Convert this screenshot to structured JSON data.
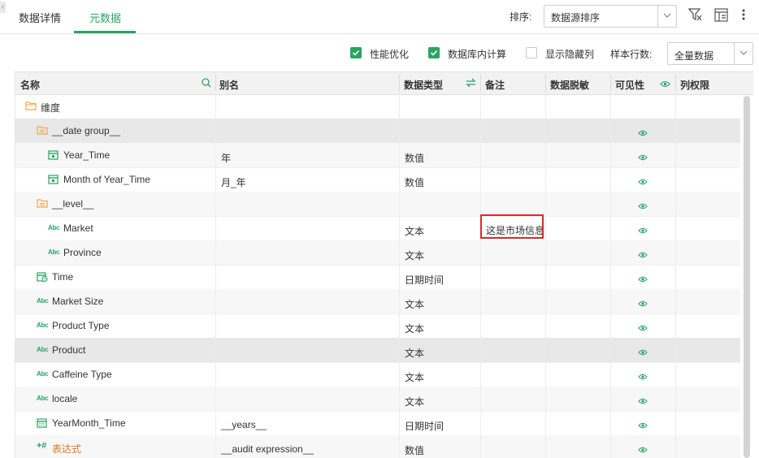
{
  "tabs": [
    {
      "label": "数据详情",
      "active": false
    },
    {
      "label": "元数据",
      "active": true
    }
  ],
  "toolbar": {
    "sort_label": "排序:",
    "sort_value": "数据源排序"
  },
  "options": {
    "perf_opt": {
      "label": "性能优化",
      "checked": true
    },
    "db_calc": {
      "label": "数据库内计算",
      "checked": true
    },
    "show_hidden": {
      "label": "显示隐藏列",
      "checked": false
    },
    "sample_label": "样本行数:",
    "sample_value": "全量数据"
  },
  "table": {
    "headers": {
      "name": "名称",
      "alias": "别名",
      "type": "数据类型",
      "note": "备注",
      "mask": "数据脱敏",
      "visible": "可见性",
      "perm": "列权限"
    },
    "rows": [
      {
        "name": "维度",
        "alias": "",
        "type": "",
        "note": "",
        "icon": "folder-icon",
        "visible": false
      },
      {
        "name": "__date group__",
        "alias": "",
        "type": "",
        "note": "",
        "icon": "folder-group-icon",
        "visible": true
      },
      {
        "name": "Year_Time",
        "alias": "年",
        "type": "数值",
        "note": "",
        "icon": "calendar-icon",
        "visible": true
      },
      {
        "name": "Month of Year_Time",
        "alias": "月_年",
        "type": "数值",
        "note": "",
        "icon": "calendar-icon",
        "visible": true
      },
      {
        "name": "__level__",
        "alias": "",
        "type": "",
        "note": "",
        "icon": "folder-group-icon",
        "visible": true
      },
      {
        "name": "Market",
        "alias": "",
        "type": "文本",
        "note": "这是市场信息",
        "icon": "abc-icon",
        "visible": true
      },
      {
        "name": "Province",
        "alias": "",
        "type": "文本",
        "note": "",
        "icon": "abc-icon",
        "visible": true
      },
      {
        "name": "Time",
        "alias": "",
        "type": "日期时间",
        "note": "",
        "icon": "datetime-icon",
        "visible": true
      },
      {
        "name": "Market Size",
        "alias": "",
        "type": "文本",
        "note": "",
        "icon": "abc-icon",
        "visible": true
      },
      {
        "name": "Product Type",
        "alias": "",
        "type": "文本",
        "note": "",
        "icon": "abc-icon",
        "visible": true
      },
      {
        "name": "Product",
        "alias": "",
        "type": "文本",
        "note": "",
        "icon": "abc-icon",
        "visible": true
      },
      {
        "name": "Caffeine Type",
        "alias": "",
        "type": "文本",
        "note": "",
        "icon": "abc-icon",
        "visible": true
      },
      {
        "name": "locale",
        "alias": "",
        "type": "文本",
        "note": "",
        "icon": "abc-icon",
        "visible": true
      },
      {
        "name": "YearMonth_Time",
        "alias": "__years__",
        "type": "日期时间",
        "note": "",
        "icon": "calendar-grid-icon",
        "visible": true
      },
      {
        "name": "表达式",
        "alias": "__audit expression__",
        "type": "数值",
        "note": "",
        "icon": "expression-icon",
        "visible": true
      }
    ],
    "abc_glyph": "Abc",
    "expr_glyph": "+#"
  },
  "colors": {
    "accent": "#27a462",
    "folder": "#f0a64a",
    "highlight_border": "#d92a2a"
  }
}
